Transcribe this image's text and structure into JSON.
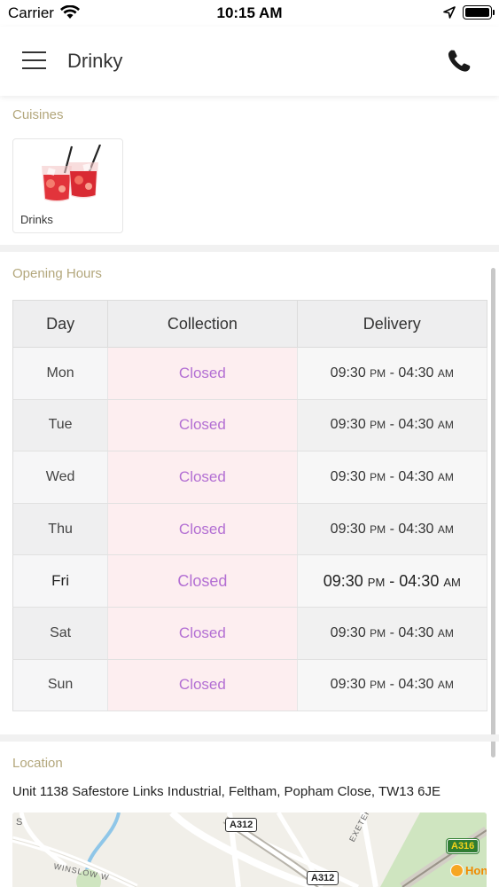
{
  "status_bar": {
    "carrier": "Carrier",
    "time": "10:15 AM"
  },
  "header": {
    "title": "Drinky"
  },
  "cuisines": {
    "title": "Cuisines",
    "items": [
      {
        "label": "Drinks",
        "icon": "cocktail-image"
      }
    ]
  },
  "opening_hours": {
    "title": "Opening Hours",
    "columns": [
      "Day",
      "Collection",
      "Delivery"
    ],
    "rows": [
      {
        "day": "Mon",
        "collection": "Closed",
        "delivery_start": "09:30",
        "delivery_start_ampm": "PM",
        "delivery_end": "04:30",
        "delivery_end_ampm": "AM"
      },
      {
        "day": "Tue",
        "collection": "Closed",
        "delivery_start": "09:30",
        "delivery_start_ampm": "PM",
        "delivery_end": "04:30",
        "delivery_end_ampm": "AM"
      },
      {
        "day": "Wed",
        "collection": "Closed",
        "delivery_start": "09:30",
        "delivery_start_ampm": "PM",
        "delivery_end": "04:30",
        "delivery_end_ampm": "AM"
      },
      {
        "day": "Thu",
        "collection": "Closed",
        "delivery_start": "09:30",
        "delivery_start_ampm": "PM",
        "delivery_end": "04:30",
        "delivery_end_ampm": "AM"
      },
      {
        "day": "Fri",
        "collection": "Closed",
        "delivery_start": "09:30",
        "delivery_start_ampm": "PM",
        "delivery_end": "04:30",
        "delivery_end_ampm": "AM"
      },
      {
        "day": "Sat",
        "collection": "Closed",
        "delivery_start": "09:30",
        "delivery_start_ampm": "PM",
        "delivery_end": "04:30",
        "delivery_end_ampm": "AM"
      },
      {
        "day": "Sun",
        "collection": "Closed",
        "delivery_start": "09:30",
        "delivery_start_ampm": "PM",
        "delivery_end": "04:30",
        "delivery_end_ampm": "AM"
      }
    ]
  },
  "location": {
    "title": "Location",
    "address": "Unit 1138 Safestore Links Industrial, Feltham, Popham Close, TW13 6JE",
    "map": {
      "road_a312": "A312",
      "road_a312_b": "A312",
      "road_a316": "A316",
      "exeter_road": "EXETER ROAD",
      "winslow": "WINSLOW W",
      "poi_partial": "Hon"
    }
  },
  "colors": {
    "section_title": "#b3a77c",
    "closed_text": "#b36fd3",
    "closed_bg": "#fdeef0",
    "a316_badge": "#2f7d32"
  }
}
